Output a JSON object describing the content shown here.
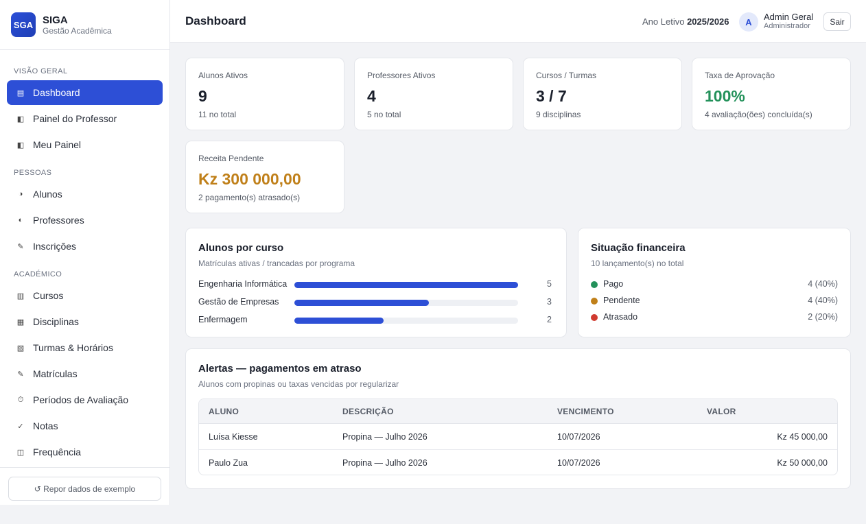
{
  "brand": {
    "logo": "SGA",
    "name": "SIGA",
    "subtitle": "Gestão Acadêmica"
  },
  "sidebar": {
    "sections": [
      {
        "label": "VISÃO GERAL",
        "items": [
          {
            "label": "Dashboard",
            "icon": "list-icon",
            "glyph": "▤",
            "active": true
          },
          {
            "label": "Painel do Professor",
            "icon": "panel-icon",
            "glyph": "◧"
          },
          {
            "label": "Meu Painel",
            "icon": "panel-icon",
            "glyph": "◧"
          }
        ]
      },
      {
        "label": "PESSOAS",
        "items": [
          {
            "label": "Alunos",
            "icon": "half-circle-icon",
            "glyph": "◑"
          },
          {
            "label": "Professores",
            "icon": "half-circle-icon",
            "glyph": "◐"
          },
          {
            "label": "Inscrições",
            "icon": "pencil-icon",
            "glyph": "✎"
          }
        ]
      },
      {
        "label": "ACADÉMICO",
        "items": [
          {
            "label": "Cursos",
            "icon": "columns-icon",
            "glyph": "▥"
          },
          {
            "label": "Disciplinas",
            "icon": "grid-icon",
            "glyph": "▦"
          },
          {
            "label": "Turmas & Horários",
            "icon": "hatch-icon",
            "glyph": "▧"
          },
          {
            "label": "Matrículas",
            "icon": "pencil-icon",
            "glyph": "✎"
          },
          {
            "label": "Períodos de Avaliação",
            "icon": "timer-icon",
            "glyph": "⏱"
          },
          {
            "label": "Notas",
            "icon": "check-icon",
            "glyph": "✓"
          },
          {
            "label": "Frequência",
            "icon": "columns-icon",
            "glyph": "◫"
          }
        ]
      }
    ],
    "reset_label": "↺ Repor dados de exemplo"
  },
  "header": {
    "title": "Dashboard",
    "year_label": "Ano Letivo",
    "year_value": "2025/2026",
    "avatar_initial": "A",
    "user_name": "Admin Geral",
    "user_role": "Administrador",
    "logout_label": "Sair"
  },
  "stats": [
    {
      "label": "Alunos Ativos",
      "value": "9",
      "sub": "11 no total"
    },
    {
      "label": "Professores Ativos",
      "value": "4",
      "sub": "5 no total"
    },
    {
      "label": "Cursos / Turmas",
      "value": "3 / 7",
      "sub": "9 disciplinas"
    },
    {
      "label": "Taxa de Aprovação",
      "value": "100%",
      "sub": "4 avaliação(ões) concluída(s)",
      "color": "#23915a"
    },
    {
      "label": "Receita Pendente",
      "value": "Kz 300 000,00",
      "sub": "2 pagamento(s) atrasado(s)",
      "color": "#c0801a"
    }
  ],
  "students_by_course": {
    "title": "Alunos por curso",
    "subtitle": "Matrículas ativas / trancadas por programa",
    "max": 5,
    "rows": [
      {
        "name": "Engenharia Informática",
        "value": 5
      },
      {
        "name": "Gestão de Empresas",
        "value": 3
      },
      {
        "name": "Enfermagem",
        "value": 2
      }
    ]
  },
  "finance": {
    "title": "Situação financeira",
    "subtitle": "10 lançamento(s) no total",
    "rows": [
      {
        "name": "Pago",
        "value": "4 (40%)",
        "color": "#23915a"
      },
      {
        "name": "Pendente",
        "value": "4 (40%)",
        "color": "#c0801a"
      },
      {
        "name": "Atrasado",
        "value": "2 (20%)",
        "color": "#d03a2f"
      }
    ]
  },
  "alerts": {
    "title": "Alertas — pagamentos em atraso",
    "subtitle": "Alunos com propinas ou taxas vencidas por regularizar",
    "columns": [
      "ALUNO",
      "DESCRIÇÃO",
      "VENCIMENTO",
      "VALOR"
    ],
    "rows": [
      [
        "Luísa Kiesse",
        "Propina — Julho 2026",
        "10/07/2026",
        "Kz 45 000,00"
      ],
      [
        "Paulo Zua",
        "Propina — Julho 2026",
        "10/07/2026",
        "Kz 50 000,00"
      ]
    ]
  }
}
